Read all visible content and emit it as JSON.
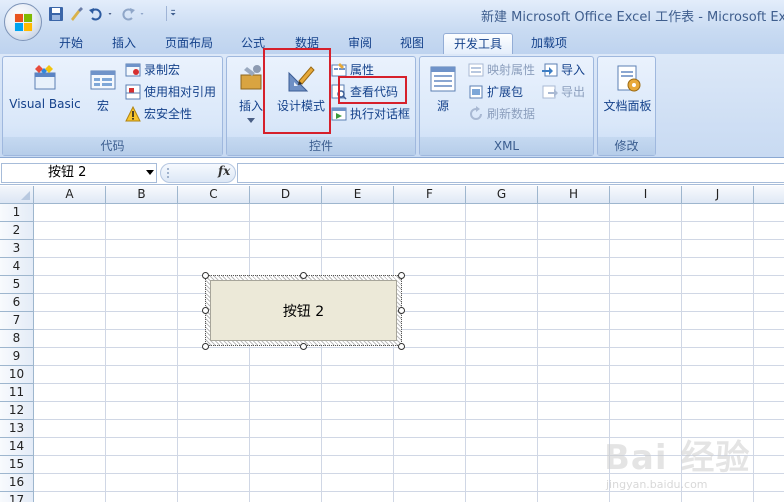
{
  "window": {
    "title": "新建 Microsoft Office Excel 工作表 - Microsoft Ex"
  },
  "tabs": [
    {
      "label": "开始",
      "active": false
    },
    {
      "label": "插入",
      "active": false
    },
    {
      "label": "页面布局",
      "active": false
    },
    {
      "label": "公式",
      "active": false
    },
    {
      "label": "数据",
      "active": false
    },
    {
      "label": "审阅",
      "active": false
    },
    {
      "label": "视图",
      "active": false
    },
    {
      "label": "开发工具",
      "active": true
    },
    {
      "label": "加载项",
      "active": false
    }
  ],
  "ribbon": {
    "code_group": {
      "label": "代码",
      "visual_basic": "Visual Basic",
      "macros": "宏",
      "record_macro": "录制宏",
      "use_relative": "使用相对引用",
      "macro_security": "宏安全性"
    },
    "controls_group": {
      "label": "控件",
      "insert": "插入",
      "design_mode": "设计模式",
      "properties": "属性",
      "view_code": "查看代码",
      "run_dialog": "执行对话框"
    },
    "xml_group": {
      "label": "XML",
      "source": "源",
      "map_properties": "映射属性",
      "expansion_packs": "扩展包",
      "refresh_data": "刷新数据",
      "import": "导入",
      "export": "导出"
    },
    "modify_group": {
      "label": "修改",
      "document_panel": "文档面板"
    }
  },
  "formula_bar": {
    "name_box": "按钮 2",
    "fx": "fx",
    "formula": ""
  },
  "grid": {
    "columns": [
      "A",
      "B",
      "C",
      "D",
      "E",
      "F",
      "G",
      "H",
      "I",
      "J"
    ],
    "rows": [
      "1",
      "2",
      "3",
      "4",
      "5",
      "6",
      "7",
      "8",
      "9",
      "10",
      "11",
      "12",
      "13",
      "14",
      "15",
      "16",
      "17"
    ]
  },
  "form_button": {
    "label": "按钮 2"
  },
  "watermark": {
    "text": "Bai 经验",
    "url": "jingyan.baidu.com"
  },
  "colors": {
    "highlight": "#d6202b",
    "ribbon_text": "#15428b",
    "gridline": "#d0d7e5"
  }
}
